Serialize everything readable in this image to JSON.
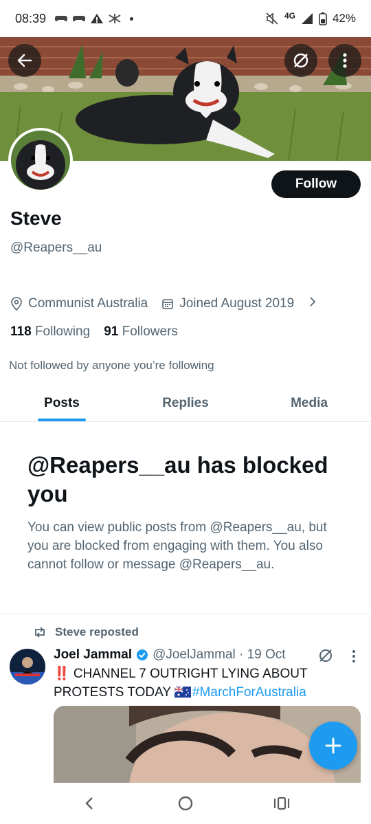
{
  "status_bar": {
    "time": "08:39",
    "network": "4G",
    "battery": "42%",
    "icons": [
      "game-controller-icon",
      "game-controller-icon",
      "warning-icon",
      "notification-icon",
      "mute-icon",
      "signal-icon",
      "battery-icon"
    ]
  },
  "profile": {
    "name": "Steve",
    "handle": "@Reapers__au",
    "follow_label": "Follow",
    "location": "Communist Australia",
    "joined": "Joined August 2019",
    "following_count": "118",
    "following_label": "Following",
    "followers_count": "91",
    "followers_label": "Followers",
    "not_followed_text": "Not followed by anyone you’re following"
  },
  "tabs": [
    {
      "label": "Posts",
      "active": true
    },
    {
      "label": "Replies",
      "active": false
    },
    {
      "label": "Media",
      "active": false
    }
  ],
  "blocked": {
    "title": "@Reapers__au has blocked you",
    "body": "You can view public posts from @Reapers__au, but you are blocked from engaging with them. You also cannot follow or message @Reapers__au."
  },
  "post": {
    "repost_label": "Steve reposted",
    "author_name": "Joel Jammal",
    "author_handle_date": "@JoelJammal · 19 Oct",
    "text_prefix": "‼️ CHANNEL 7 OUTRIGHT LYING ABOUT PROTESTS TODAY ",
    "hashtag": "#MarchForAustralia"
  },
  "colors": {
    "accent": "#1d9bf0",
    "text_primary": "#0f1419",
    "text_secondary": "#536471",
    "follow_button": "#0f1419"
  }
}
